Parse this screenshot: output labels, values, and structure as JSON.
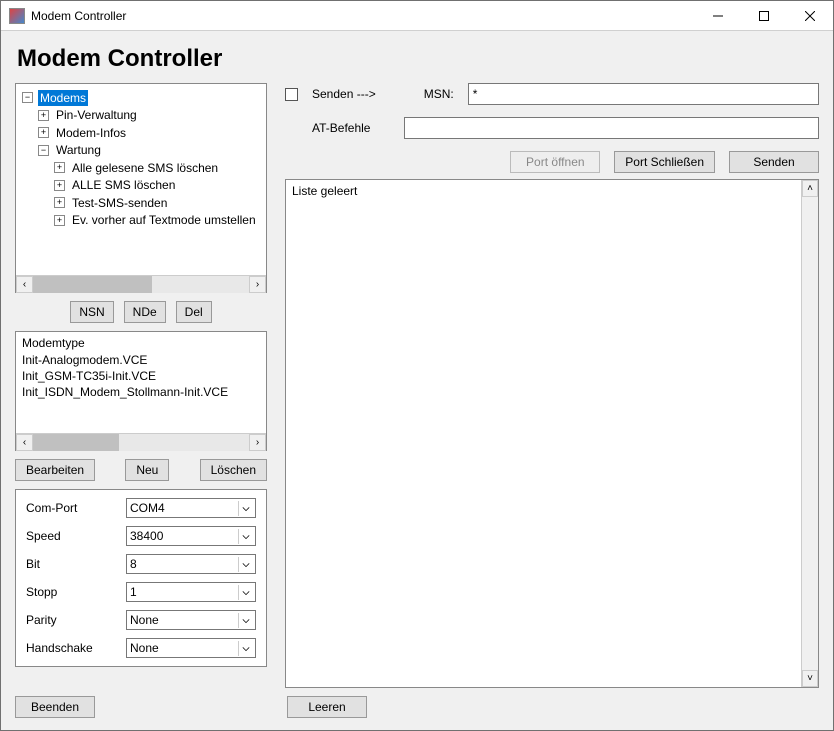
{
  "window": {
    "title": "Modem Controller"
  },
  "page_title": "Modem Controller",
  "tree": {
    "root_label": "Modems",
    "children": [
      {
        "label": "Pin-Verwaltung",
        "expandable": true
      },
      {
        "label": "Modem-Infos",
        "expandable": true
      },
      {
        "label": "Wartung",
        "expandable": true,
        "open": true,
        "children": [
          {
            "label": "Alle gelesene SMS löschen",
            "expandable": true
          },
          {
            "label": "ALLE SMS löschen",
            "expandable": true
          },
          {
            "label": "Test-SMS-senden",
            "expandable": true
          },
          {
            "label": "Ev. vorher auf Textmode umstellen",
            "expandable": true
          }
        ]
      }
    ]
  },
  "tree_buttons": {
    "nsn": "NSN",
    "nde": "NDe",
    "del": "Del"
  },
  "modemtype": {
    "header": "Modemtype",
    "items": [
      "Init-Analogmodem.VCE",
      "Init_GSM-TC35i-Init.VCE",
      "Init_ISDN_Modem_Stollmann-Init.VCE"
    ]
  },
  "mt_buttons": {
    "edit": "Bearbeiten",
    "new": "Neu",
    "delete": "Löschen"
  },
  "port": {
    "labels": {
      "com": "Com-Port",
      "speed": "Speed",
      "bit": "Bit",
      "stop": "Stopp",
      "parity": "Parity",
      "handshake": "Handschake"
    },
    "values": {
      "com": "COM4",
      "speed": "38400",
      "bit": "8",
      "stop": "1",
      "parity": "None",
      "handshake": "None"
    }
  },
  "right": {
    "send_checkbox": "Senden --->",
    "msn_label": "MSN:",
    "msn_value": "*",
    "at_label": "AT-Befehle",
    "at_value": "",
    "buttons": {
      "open": "Port öffnen",
      "close": "Port Schließen",
      "send": "Senden"
    },
    "log_text": "Liste geleert"
  },
  "footer": {
    "quit": "Beenden",
    "clear": "Leeren"
  }
}
